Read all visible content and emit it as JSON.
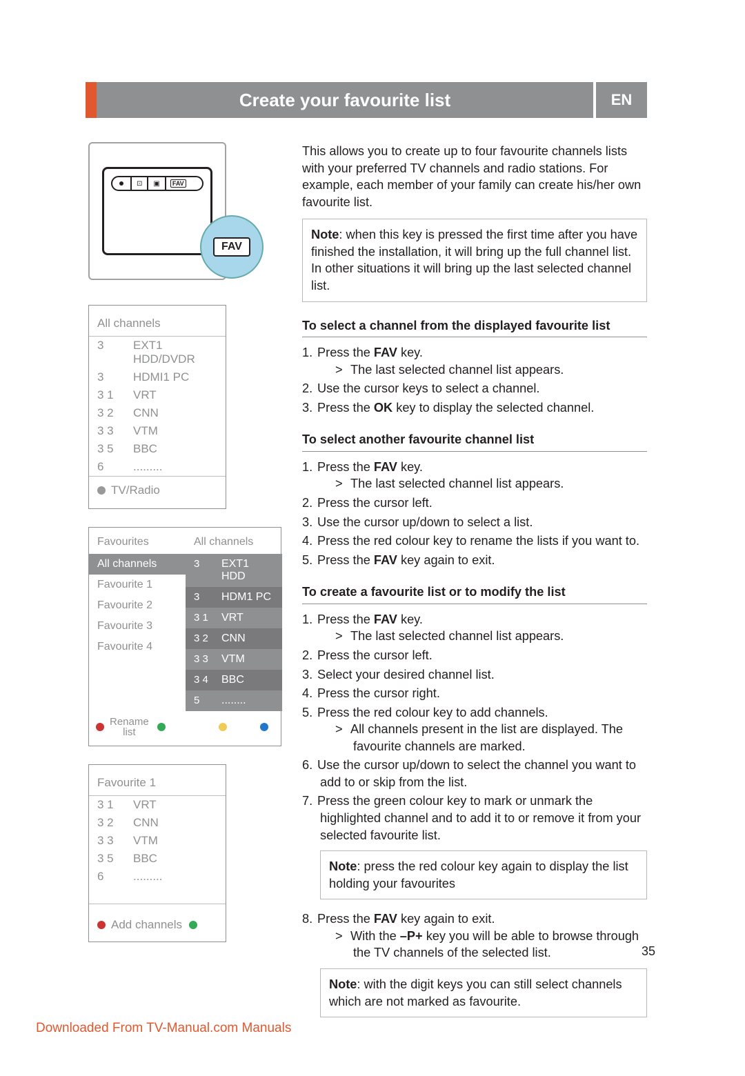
{
  "header": {
    "title": "Create your favourite list",
    "lang": "EN"
  },
  "intro": "This allows you to create up to four favourite channels lists with your preferred TV channels and radio stations. For example, each member of your family can create his/her own favourite list.",
  "note1": {
    "label": "Note",
    "text": ": when this key is pressed the first time after you have finished the installation, it will bring up the full channel list. In other situations it will bring up the last selected channel list."
  },
  "sect1": {
    "title": "To select a channel from the displayed favourite list",
    "steps": [
      {
        "n": "1.",
        "text_before": "Press the ",
        "bold": "FAV",
        "text_after": " key.",
        "sub": "The last selected channel list appears."
      },
      {
        "n": "2.",
        "text": "Use the cursor keys to select a channel."
      },
      {
        "n": "3.",
        "text_before": "Press the ",
        "bold": "OK",
        "text_after": " key to display the selected channel."
      }
    ]
  },
  "sect2": {
    "title": "To select another favourite channel list",
    "steps": [
      {
        "n": "1.",
        "text_before": "Press the ",
        "bold": "FAV",
        "text_after": " key.",
        "sub": "The last selected channel list appears."
      },
      {
        "n": "2.",
        "text": "Press the cursor left."
      },
      {
        "n": "3.",
        "text": "Use the cursor up/down to select a list."
      },
      {
        "n": "4.",
        "text": "Press the red colour key to rename the lists if you want to."
      },
      {
        "n": "5.",
        "text_before": "Press the ",
        "bold": "FAV",
        "text_after": " key again to exit."
      }
    ]
  },
  "sect3": {
    "title": "To create a favourite list or to modify the list",
    "steps": [
      {
        "n": "1.",
        "text_before": "Press the ",
        "bold": "FAV",
        "text_after": " key.",
        "sub": "The last selected channel list appears."
      },
      {
        "n": "2.",
        "text": "Press the cursor left."
      },
      {
        "n": "3.",
        "text": "Select your desired channel list."
      },
      {
        "n": "4.",
        "text": "Press the cursor right."
      },
      {
        "n": "5.",
        "text": "Press the red colour key to add channels.",
        "sub": "All channels present in the list are displayed. The favourite channels are marked."
      },
      {
        "n": "6.",
        "text": "Use the cursor up/down to select the channel you want to add to or skip from the list."
      },
      {
        "n": "7.",
        "text": "Press the green colour key to mark or unmark the highlighted channel and to add it to or remove it from your selected favourite list."
      }
    ],
    "note_mid": {
      "label": "Note",
      "text": ": press the red colour key again to display the list holding your favourites"
    },
    "steps2": [
      {
        "n": "8.",
        "text_before": "Press the ",
        "bold": "FAV",
        "text_after": " key again to exit.",
        "sub_before": "With the ",
        "sub_bold": "–P+",
        "sub_after": " key you will be able to browse through the TV channels of the selected list."
      }
    ],
    "note_end": {
      "label": "Note",
      "text": ": with the digit keys you can still select channels which are not marked as favourite."
    }
  },
  "fig1": {
    "title": "All channels",
    "rows": [
      {
        "a": "3",
        "b": "EXT1    HDD/DVDR"
      },
      {
        "a": "3",
        "b": "HDMI1 PC"
      },
      {
        "a": "3 1",
        "b": "VRT"
      },
      {
        "a": "3 2",
        "b": "CNN"
      },
      {
        "a": "3 3",
        "b": "VTM"
      },
      {
        "a": "3 5",
        "b": "BBC"
      },
      {
        "a": "  6",
        "b": "........."
      }
    ],
    "foot": "TV/Radio"
  },
  "fig2": {
    "left_head": "Favourites",
    "right_head": "All channels",
    "left": [
      "All channels",
      "Favourite 1",
      "Favourite 2",
      "Favourite 3",
      "Favourite 4"
    ],
    "right": [
      {
        "a": "3",
        "b": "EXT1   HDD"
      },
      {
        "a": "3",
        "b": "HDM1  PC"
      },
      {
        "a": "3 1",
        "b": "VRT"
      },
      {
        "a": "3 2",
        "b": "CNN"
      },
      {
        "a": "3 3",
        "b": "VTM"
      },
      {
        "a": "3 4",
        "b": "BBC"
      },
      {
        "a": "  5",
        "b": "........"
      }
    ],
    "foot": "Rename\nlist"
  },
  "fig3": {
    "title": "Favourite 1",
    "rows": [
      {
        "a": "3 1",
        "b": "VRT"
      },
      {
        "a": "3 2",
        "b": "CNN"
      },
      {
        "a": "3 3",
        "b": "VTM"
      },
      {
        "a": "3 5",
        "b": "BBC"
      },
      {
        "a": "  6",
        "b": "........."
      }
    ],
    "foot": "Add channels"
  },
  "callout_label": "FAV",
  "favmini": "FAV",
  "page_number": "35",
  "download": "Downloaded From TV-Manual.com Manuals"
}
